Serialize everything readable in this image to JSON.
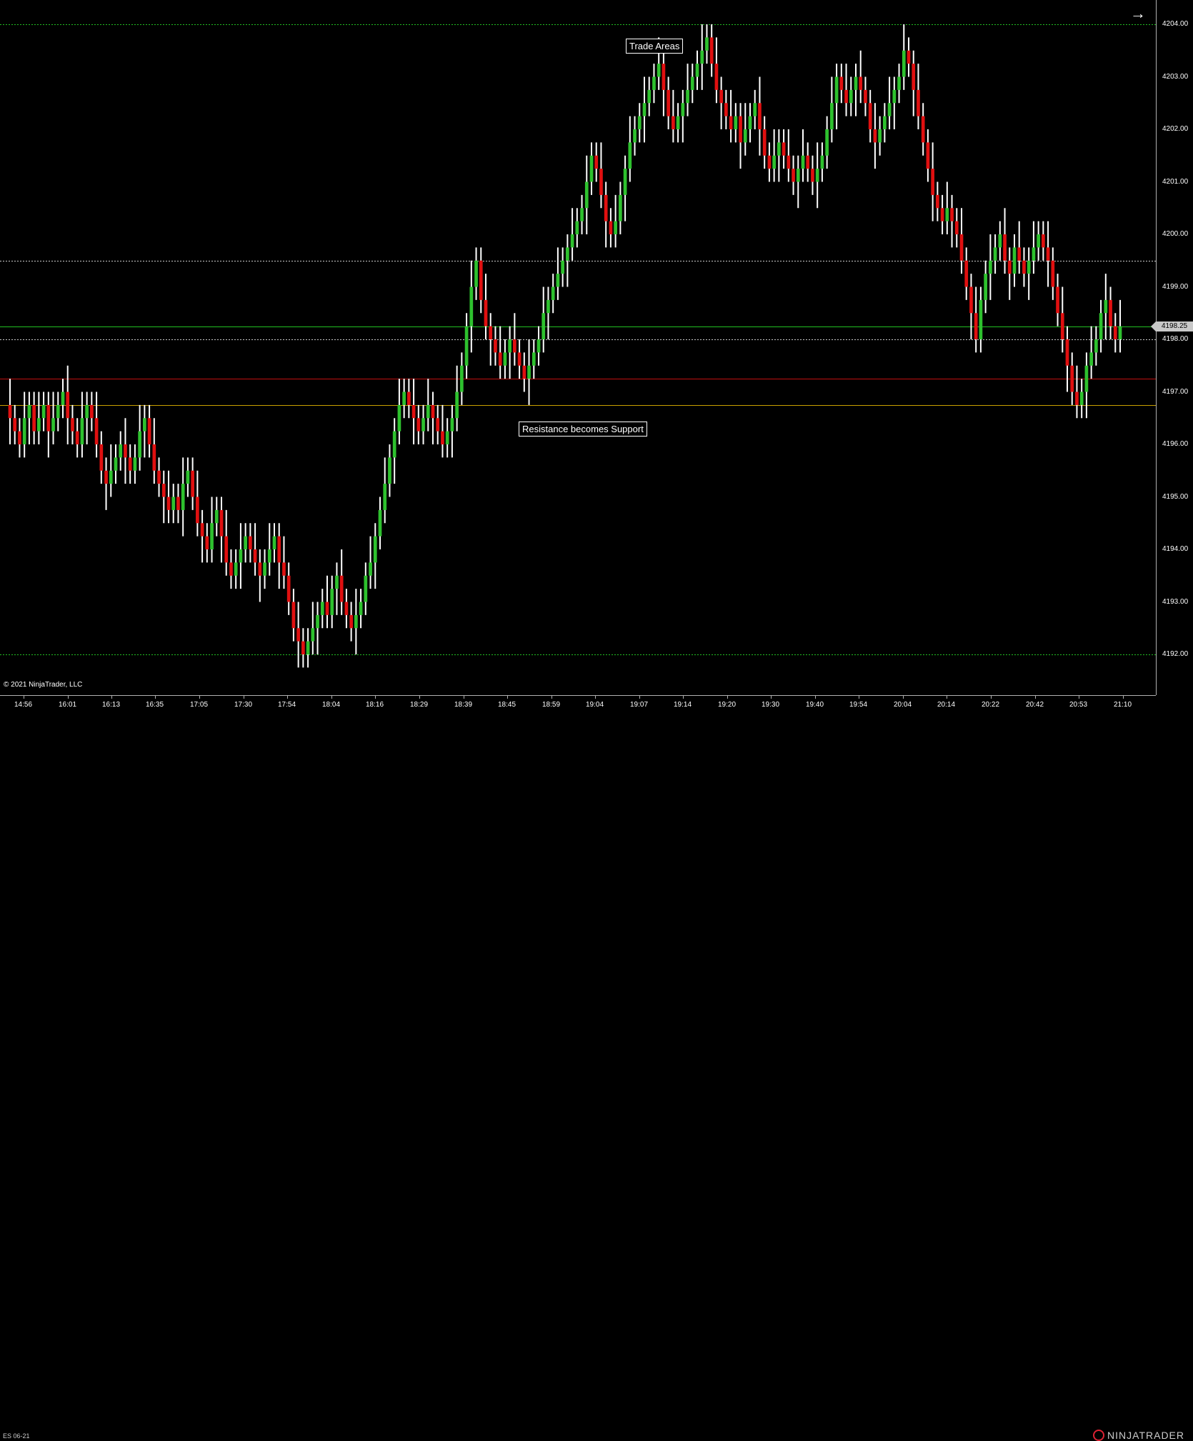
{
  "instrument": "ES 06-21",
  "copyright": "© 2021 NinjaTrader, LLC",
  "brand": "NINJATRADER",
  "annotations": {
    "trade_areas": "Trade Areas",
    "resistance_support": "Resistance becomes Support"
  },
  "last_price_label": "4198.25",
  "colors": {
    "up": "#2ec12e",
    "down": "#e01010",
    "wick": "#ffffff",
    "background": "#000000"
  },
  "icons": {
    "arrow": "arrow-right-icon"
  },
  "chart_data": {
    "type": "candlestick",
    "y_ticks": [
      "4204.00",
      "4203.00",
      "4202.00",
      "4201.00",
      "4200.00",
      "4199.00",
      "4198.00",
      "4197.00",
      "4196.00",
      "4195.00",
      "4194.00",
      "4193.00",
      "4192.00"
    ],
    "x_ticks": [
      "14:56",
      "16:01",
      "16:13",
      "16:35",
      "17:05",
      "17:30",
      "17:54",
      "18:04",
      "18:16",
      "18:29",
      "18:39",
      "18:45",
      "18:59",
      "19:04",
      "19:07",
      "19:14",
      "19:20",
      "19:30",
      "19:40",
      "19:54",
      "20:04",
      "20:14",
      "20:22",
      "20:42",
      "20:53",
      "21:10"
    ],
    "ylim": [
      4191.5,
      4204.25
    ],
    "levels": [
      {
        "price": 4204.0,
        "color": "#22c022",
        "style": "dotted"
      },
      {
        "price": 4199.5,
        "color": "#cccccc",
        "style": "dotted"
      },
      {
        "price": 4198.25,
        "color": "#22c022",
        "style": "solid"
      },
      {
        "price": 4198.0,
        "color": "#cccccc",
        "style": "dotted"
      },
      {
        "price": 4197.25,
        "color": "#c01010",
        "style": "solid"
      },
      {
        "price": 4196.75,
        "color": "#c8a000",
        "style": "solid"
      },
      {
        "price": 4192.0,
        "color": "#22c022",
        "style": "dotted"
      }
    ],
    "closes": [
      4196.5,
      4196.25,
      4196.0,
      4196.5,
      4196.75,
      4196.25,
      4196.5,
      4196.75,
      4196.25,
      4196.5,
      4196.75,
      4197.0,
      4196.5,
      4196.25,
      4196.0,
      4196.5,
      4196.75,
      4196.5,
      4196.0,
      4195.5,
      4195.25,
      4195.5,
      4195.75,
      4196.0,
      4195.75,
      4195.5,
      4195.75,
      4196.25,
      4196.5,
      4196.0,
      4195.5,
      4195.25,
      4195.0,
      4194.75,
      4195.0,
      4194.75,
      4195.25,
      4195.5,
      4195.0,
      4194.5,
      4194.25,
      4194.0,
      4194.5,
      4194.75,
      4194.25,
      4193.75,
      4193.5,
      4193.75,
      4194.0,
      4194.25,
      4194.0,
      4193.75,
      4193.5,
      4193.75,
      4194.0,
      4194.25,
      4193.75,
      4193.5,
      4193.0,
      4192.5,
      4192.25,
      4192.0,
      4192.25,
      4192.5,
      4192.75,
      4193.0,
      4192.75,
      4193.25,
      4193.5,
      4193.0,
      4192.75,
      4192.5,
      4192.75,
      4193.0,
      4193.5,
      4193.75,
      4194.25,
      4194.75,
      4195.25,
      4195.75,
      4196.25,
      4196.75,
      4197.0,
      4196.75,
      4196.5,
      4196.25,
      4196.5,
      4196.75,
      4196.5,
      4196.25,
      4196.0,
      4196.25,
      4196.5,
      4197.0,
      4197.5,
      4198.25,
      4199.0,
      4199.5,
      4198.75,
      4198.25,
      4198.0,
      4197.75,
      4197.5,
      4197.75,
      4198.0,
      4197.75,
      4197.5,
      4197.25,
      4197.5,
      4197.75,
      4198.0,
      4198.5,
      4198.75,
      4199.0,
      4199.25,
      4199.5,
      4199.75,
      4200.0,
      4200.25,
      4200.5,
      4201.0,
      4201.5,
      4201.25,
      4200.75,
      4200.25,
      4200.0,
      4200.25,
      4200.75,
      4201.25,
      4201.75,
      4202.0,
      4202.25,
      4202.5,
      4202.75,
      4203.0,
      4203.25,
      4202.75,
      4202.25,
      4202.0,
      4202.25,
      4202.5,
      4202.75,
      4203.0,
      4203.25,
      4203.5,
      4203.75,
      4203.25,
      4202.75,
      4202.5,
      4202.25,
      4202.0,
      4202.25,
      4201.75,
      4202.0,
      4202.25,
      4202.5,
      4202.0,
      4201.5,
      4201.25,
      4201.5,
      4201.75,
      4201.5,
      4201.25,
      4201.0,
      4201.25,
      4201.5,
      4201.25,
      4201.0,
      4201.25,
      4201.5,
      4202.0,
      4202.5,
      4203.0,
      4202.75,
      4202.5,
      4202.75,
      4203.0,
      4202.75,
      4202.5,
      4202.0,
      4201.75,
      4202.0,
      4202.25,
      4202.5,
      4202.75,
      4203.0,
      4203.5,
      4203.25,
      4202.75,
      4202.25,
      4201.75,
      4201.25,
      4200.75,
      4200.5,
      4200.25,
      4200.5,
      4200.25,
      4200.0,
      4199.5,
      4199.0,
      4198.5,
      4198.0,
      4198.75,
      4199.25,
      4199.5,
      4199.75,
      4200.0,
      4199.5,
      4199.25,
      4199.75,
      4199.5,
      4199.25,
      4199.5,
      4199.75,
      4200.0,
      4199.75,
      4199.5,
      4199.0,
      4198.5,
      4198.0,
      4197.5,
      4197.0,
      4196.75,
      4197.0,
      4197.5,
      4197.75,
      4198.0,
      4198.5,
      4198.75,
      4198.25,
      4198.0,
      4198.25
    ]
  }
}
